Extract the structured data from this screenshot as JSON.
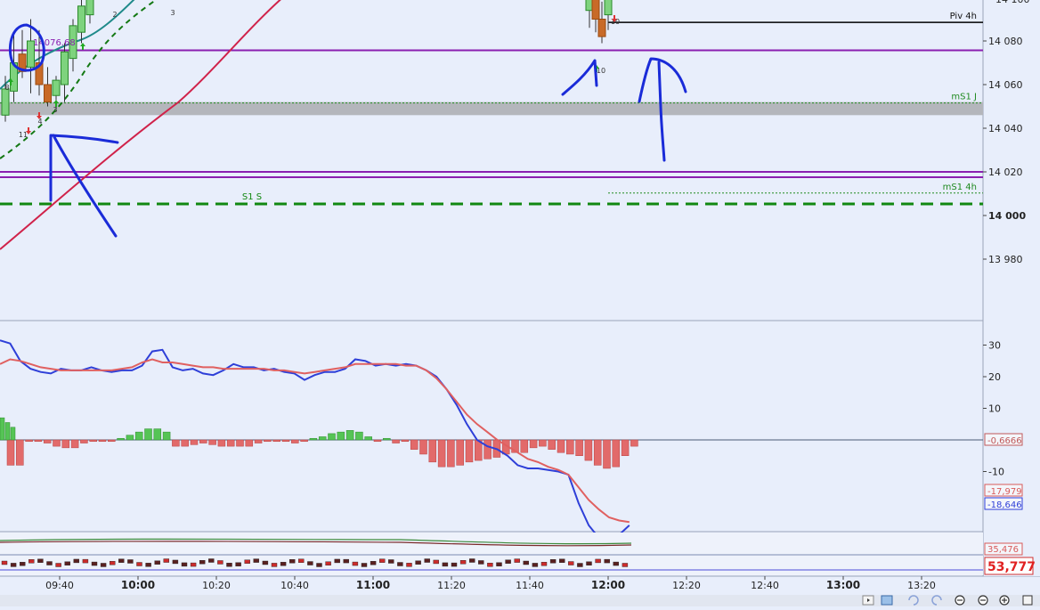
{
  "chart_data": [
    {
      "type": "candlestick",
      "price_axis": {
        "ticks": [
          "14 080",
          "14 060",
          "14 040",
          "14 020",
          "14 000",
          "13 980"
        ],
        "major": "14 000",
        "top_partial": "14 100"
      },
      "levels": [
        {
          "label": "Piv 4h",
          "value": 14088.5,
          "color": "#000000",
          "style": "solid"
        },
        {
          "label": "",
          "value": 14075.7,
          "color": "#8a1fb0",
          "style": "solid"
        },
        {
          "label": "mS1 J",
          "value": 14051.6,
          "color": "#1f8a1f",
          "style": "dotted"
        },
        {
          "label": "",
          "value": 14018.8,
          "color": "#8a1fb0",
          "style": "double"
        },
        {
          "label": "mS1 4h",
          "value": 14010.3,
          "color": "#1f8a1f",
          "style": "dotted"
        },
        {
          "label": "S1 S",
          "value": 14005.3,
          "color": "#118811",
          "style": "dashed"
        }
      ],
      "zone": {
        "from": 14046.0,
        "to": 14052.0,
        "color": "#b4b6bc"
      },
      "price_marker": "14076.68",
      "bar_counts": [
        "8",
        "11",
        "4",
        "3",
        "2",
        "3",
        "10",
        "10"
      ],
      "candles": [
        {
          "o": 14046,
          "h": 14064,
          "l": 14043,
          "c": 14058
        },
        {
          "o": 14057,
          "h": 14083,
          "l": 14052,
          "c": 14070
        },
        {
          "o": 14074,
          "h": 14085,
          "l": 14063,
          "c": 14066
        },
        {
          "o": 14068,
          "h": 14090,
          "l": 14056,
          "c": 14080
        },
        {
          "o": 14070,
          "h": 14085,
          "l": 14055,
          "c": 14060
        },
        {
          "o": 14060,
          "h": 14068,
          "l": 14050,
          "c": 14052
        },
        {
          "o": 14055,
          "h": 14064,
          "l": 14049,
          "c": 14062
        },
        {
          "o": 14060,
          "h": 14079,
          "l": 14052,
          "c": 14075
        },
        {
          "o": 14072,
          "h": 14090,
          "l": 14066,
          "c": 14087
        },
        {
          "o": 14084,
          "h": 14100,
          "l": 14079,
          "c": 14096
        },
        {
          "o": 14092,
          "h": 14110,
          "l": 14088,
          "c": 14104
        }
      ],
      "late_candles": [
        {
          "o": 14094,
          "h": 14102,
          "l": 14086,
          "c": 14100
        },
        {
          "o": 14106,
          "h": 14108,
          "l": 14084,
          "c": 14090
        },
        {
          "o": 14090,
          "h": 14098,
          "l": 14079,
          "c": 14082
        },
        {
          "o": 14092,
          "h": 14104,
          "l": 14085,
          "c": 14100
        }
      ]
    },
    {
      "type": "line",
      "indicator": "macd",
      "axis_ticks": [
        "30",
        "20",
        "10",
        "-10"
      ],
      "value_labels": [
        {
          "text": "-0,6666",
          "color": "#c05858"
        },
        {
          "text": "-17,979",
          "color": "#d85a5a"
        },
        {
          "text": "-18,646",
          "color": "#2e3fd8"
        }
      ],
      "series": [
        {
          "name": "",
          "color": "#2e3fd8",
          "values": [
            31.5,
            30.5,
            25,
            22.5,
            21.5,
            21,
            22.5,
            22,
            22,
            23,
            22,
            21.5,
            22,
            22,
            23.5,
            28,
            28.5,
            23,
            22,
            22.5,
            21,
            20.5,
            22,
            24,
            23,
            23,
            22,
            22.5,
            21.5,
            21,
            19,
            20.5,
            21.5,
            21.5,
            22.5,
            25.5,
            25,
            23.5,
            24,
            23.5,
            24,
            23.5,
            22,
            20,
            16,
            11,
            5,
            0,
            -2,
            -3,
            -5,
            -8,
            -9,
            -9,
            -9.5,
            -10,
            -11,
            -20,
            -27,
            -31,
            -32,
            -30,
            -27
          ]
        },
        {
          "name": "",
          "color": "#e06060",
          "values": [
            24,
            25.5,
            25,
            24,
            23,
            22.5,
            22,
            22,
            22,
            22,
            22,
            22,
            22.5,
            23,
            24.5,
            25.5,
            24.5,
            24.5,
            24,
            23.5,
            23,
            23,
            22.5,
            22.5,
            22.5,
            22.5,
            22.5,
            22,
            22,
            21.5,
            21,
            21.5,
            22,
            22.5,
            23,
            24,
            24,
            24,
            24,
            24,
            23.5,
            23.5,
            22,
            19.5,
            16,
            12,
            8,
            5,
            2.5,
            0,
            -2,
            -4,
            -6,
            -7,
            -8.5,
            -9.5,
            -11,
            -15,
            -19,
            -22,
            -24.5,
            -25.5,
            -26
          ]
        },
        {
          "name": "",
          "type": "bar",
          "values": [
            -8,
            -8,
            -0.5,
            -0.5,
            -1,
            -2,
            -2.5,
            -2.5,
            -1,
            -0.5,
            -0.5,
            -0.5,
            0.5,
            1.5,
            2.5,
            3.5,
            3.5,
            2.5,
            -2,
            -2,
            -1.5,
            -1,
            -1.5,
            -2,
            -2,
            -2,
            -2,
            -1,
            -0.5,
            -0.5,
            -0.5,
            -1,
            -0.5,
            0.5,
            1,
            2,
            2.5,
            3,
            2.5,
            1,
            -0.5,
            0.5,
            -1,
            -0.5,
            -3,
            -4.5,
            -7,
            -8.5,
            -8.5,
            -8,
            -7,
            -6.5,
            -6,
            -5.5,
            -4.5,
            -4,
            -4,
            -2.5,
            -2,
            -3,
            -4,
            -4.5,
            -5,
            -6.5,
            -8,
            -9,
            -8.5,
            -5,
            -2
          ]
        },
        {
          "name": "",
          "type": "bar_positive",
          "values": [
            7,
            5.5,
            4
          ]
        }
      ]
    },
    {
      "type": "line",
      "indicator": "oscillator",
      "value_labels": [
        {
          "text": "35,476",
          "color": "#d85a5a"
        },
        {
          "text": "53,777",
          "color": "#e02020"
        }
      ]
    }
  ],
  "time_axis": {
    "labels": [
      "09:40",
      "10:00",
      "10:20",
      "10:40",
      "11:00",
      "11:20",
      "11:40",
      "12:00",
      "12:20",
      "12:40",
      "13:00",
      "13:20"
    ],
    "bold": [
      "10:00",
      "11:00",
      "12:00",
      "13:00"
    ]
  },
  "colors": {
    "background": "#e8eefb",
    "annotation": "#1a2bd8",
    "ma_fast": "#1f8a8a",
    "ma_slow": "#d0224a",
    "stop_line": "#137813"
  }
}
